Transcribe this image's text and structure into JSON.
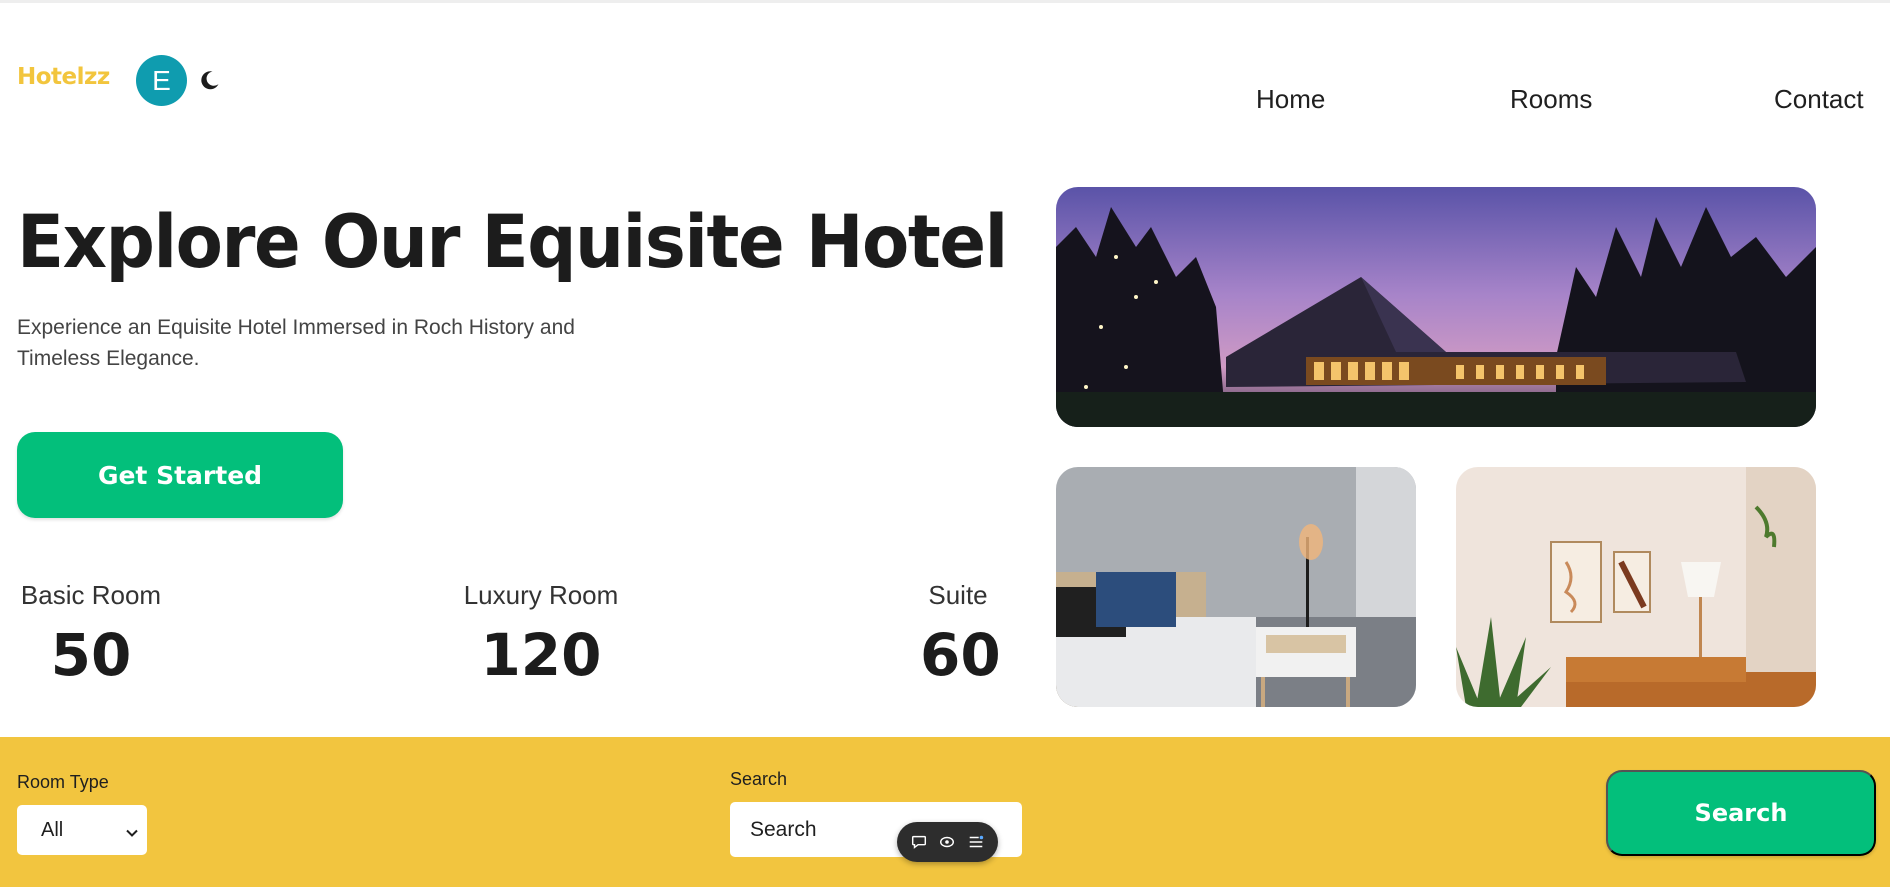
{
  "header": {
    "logo": "Hotelzz",
    "avatar_initial": "E",
    "theme_icon": "moon-icon",
    "nav": [
      {
        "label": "Home"
      },
      {
        "label": "Rooms"
      },
      {
        "label": "Contact"
      }
    ]
  },
  "hero": {
    "title": "Explore Our Equisite Hotel",
    "subtitle": "Experience an Equisite Hotel Immersed in Roch History and Timeless Elegance.",
    "cta_label": "Get Started",
    "stats": [
      {
        "label": "Basic Room",
        "value": "50"
      },
      {
        "label": "Luxury Room",
        "value": "120"
      },
      {
        "label": "Suite",
        "value": "60"
      }
    ]
  },
  "gallery": {
    "images": [
      "hotel-exterior-dusk-image",
      "bedroom-nightstand-image",
      "living-room-sofa-image"
    ]
  },
  "search_bar": {
    "room_type_label": "Room Type",
    "room_type_selected": "All",
    "search_label": "Search",
    "search_placeholder": "Search",
    "search_button": "Search"
  },
  "floating_toolbar": {
    "icons": [
      "comment-icon",
      "eye-icon",
      "list-icon"
    ]
  },
  "colors": {
    "brand_yellow": "#f2c53f",
    "accent_green": "#03bf7b",
    "avatar_teal": "#0f9caf"
  }
}
